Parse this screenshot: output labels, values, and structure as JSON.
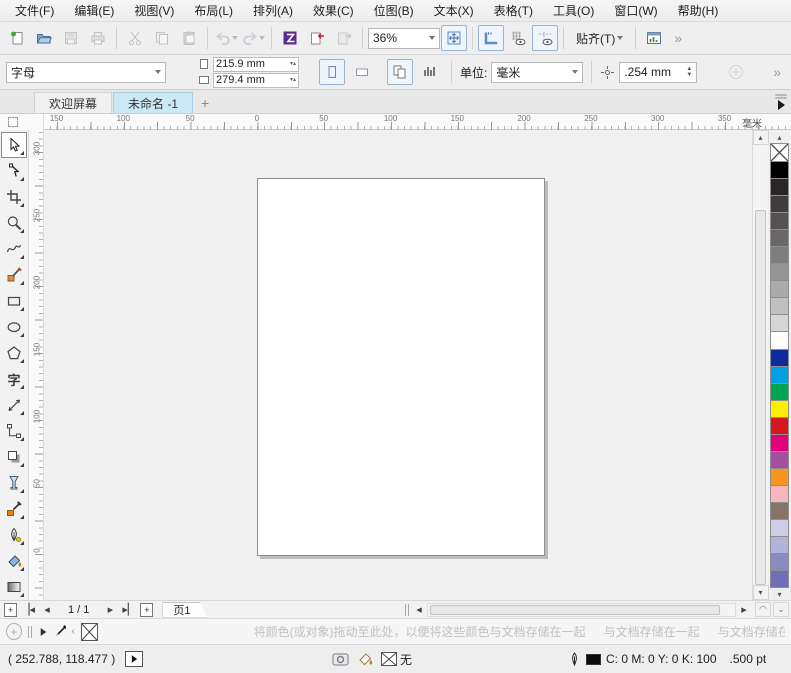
{
  "menu": {
    "items": [
      "文件(F)",
      "编辑(E)",
      "视图(V)",
      "布局(L)",
      "排列(A)",
      "效果(C)",
      "位图(B)",
      "文本(X)",
      "表格(T)",
      "工具(O)",
      "窗口(W)",
      "帮助(H)"
    ]
  },
  "toolbar": {
    "zoom_level": "36%",
    "snap_label": "贴齐(T)",
    "overflow": "»",
    "icons": [
      "new-document",
      "open",
      "save",
      "print",
      "cut",
      "copy",
      "paste",
      "undo",
      "redo",
      "search-content",
      "import",
      "export",
      "zoom-levels",
      "fit-page",
      "rulers-toggle",
      "grid-toggle",
      "guidelines-toggle",
      "snap-menu",
      "options"
    ]
  },
  "property_bar": {
    "preset": "字母",
    "page_width": "215.9 mm",
    "page_height": "279.4 mm",
    "units_label": "单位:",
    "units_value": "毫米",
    "nudge_value": ".254 mm",
    "overflow": "»"
  },
  "tabs": {
    "items": [
      {
        "label": "欢迎屏幕"
      },
      {
        "label": "未命名 -1"
      }
    ],
    "new_tab": "+"
  },
  "rulers": {
    "horizontal": {
      "labels": [
        "150",
        "100",
        "50",
        "0",
        "50",
        "100",
        "150",
        "200",
        "250",
        "300",
        "350"
      ],
      "unit": "毫米"
    },
    "vertical": {
      "labels": [
        "300",
        "250",
        "200",
        "150",
        "100",
        "50",
        "0"
      ]
    }
  },
  "toolbox": {
    "text_tool_glyph": "字",
    "tools": [
      "pick",
      "shape",
      "crop",
      "zoom",
      "freehand",
      "smart-drawing",
      "rectangle",
      "ellipse",
      "polygon",
      "text",
      "parallel-dimension",
      "connector",
      "drop-shadow",
      "transparency",
      "color-eyedropper",
      "outline-pen",
      "fill",
      "interactive-fill"
    ]
  },
  "palette": {
    "colors": [
      "#000000",
      "#2a2627",
      "#403c3d",
      "#555152",
      "#6a6767",
      "#807d7e",
      "#969394",
      "#aba9aa",
      "#c1bfc0",
      "#d7d6d6",
      "#ffffff",
      "#0e2a9e",
      "#00a0e2",
      "#00a551",
      "#fdee00",
      "#d6171f",
      "#e2007b",
      "#a4509e",
      "#f7941e",
      "#f8b5bc",
      "#857567",
      "#cccce7",
      "#b2b2db",
      "#8b8bc4",
      "#6f6fb7"
    ]
  },
  "page_nav": {
    "counter": "1 / 1",
    "page_tab": "页1"
  },
  "doc_palette": {
    "hint": "将颜色(或对象)拖动至此处，以便将这些颜色与文档存储在一起",
    "hint_repeat": "与文档存储在一起"
  },
  "status_bar": {
    "coords": "( 252.788, 118.477 )",
    "fill_none_label": "无",
    "outline_color": "C: 0 M: 0 Y: 0 K: 100",
    "outline_width": ".500 pt"
  }
}
